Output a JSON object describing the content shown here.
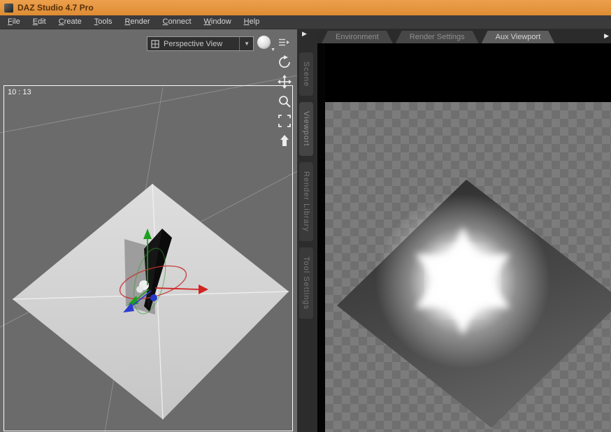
{
  "window": {
    "title": "DAZ Studio 4.7 Pro"
  },
  "menu": {
    "items": [
      "File",
      "Edit",
      "Create",
      "Tools",
      "Render",
      "Connect",
      "Window",
      "Help"
    ]
  },
  "left_viewport": {
    "camera_dropdown": {
      "label": "Perspective View"
    },
    "overlay_counter": "10 : 13",
    "tool_icons": [
      "orbit-icon",
      "pan-icon",
      "zoom-icon",
      "frame-icon",
      "camera-reset-icon"
    ],
    "header_icons": [
      "shaded-sphere-icon",
      "viewport-options-icon"
    ]
  },
  "side_tabs": {
    "items": [
      "Scene",
      "Viewport",
      "Render Library",
      "Tool Settings"
    ]
  },
  "right_panel": {
    "tabs": [
      {
        "label": "Environment",
        "active": false
      },
      {
        "label": "Render Settings",
        "active": false
      },
      {
        "label": "Aux Viewport",
        "active": true
      }
    ]
  },
  "colors": {
    "titlebar": "#e2923d",
    "axis_x": "#d22222",
    "axis_y": "#1ea01e",
    "axis_z": "#2438cc",
    "checker_light": "#7c7c7c",
    "checker_dark": "#6f6f6f"
  }
}
